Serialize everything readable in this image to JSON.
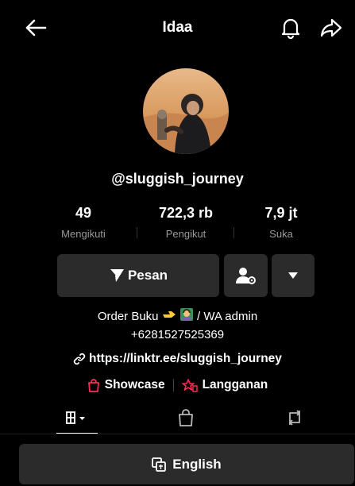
{
  "header": {
    "title": "Idaa",
    "back_icon": "arrow-left-icon",
    "bell_icon": "bell-icon",
    "share_icon": "share-arrow-icon"
  },
  "profile": {
    "username": "@sluggish_journey",
    "stats": [
      {
        "value": "49",
        "label": "Mengikuti"
      },
      {
        "value": "722,3 rb",
        "label": "Pengikut"
      },
      {
        "value": "7,9 jt",
        "label": "Suka"
      }
    ]
  },
  "actions": {
    "message_label": "Pesan",
    "message_icon": "send-arrow-icon",
    "add_friend_icon": "user-settings-icon",
    "more_icon": "caret-down-icon"
  },
  "bio": {
    "line1": "Order Buku",
    "line1_suffix": " / WA admin",
    "line2": "+6281527525369"
  },
  "link": {
    "text": "https://linktr.ee/sluggish_journey",
    "icon": "link-icon"
  },
  "extras": [
    {
      "label": "Showcase",
      "icon": "shopping-bag-icon"
    },
    {
      "label": "Langganan",
      "icon": "subscription-star-icon"
    }
  ],
  "tabs": [
    {
      "name": "videos",
      "icon": "grid-icon"
    },
    {
      "name": "shop",
      "icon": "bag-icon"
    },
    {
      "name": "reposts",
      "icon": "repost-icon"
    }
  ],
  "language_button": {
    "label": "English",
    "icon": "translate-icon"
  },
  "colors": {
    "background": "#000000",
    "button": "#2b2b2b",
    "accent_red": "#fe2c55",
    "muted": "#9a9a9a"
  }
}
